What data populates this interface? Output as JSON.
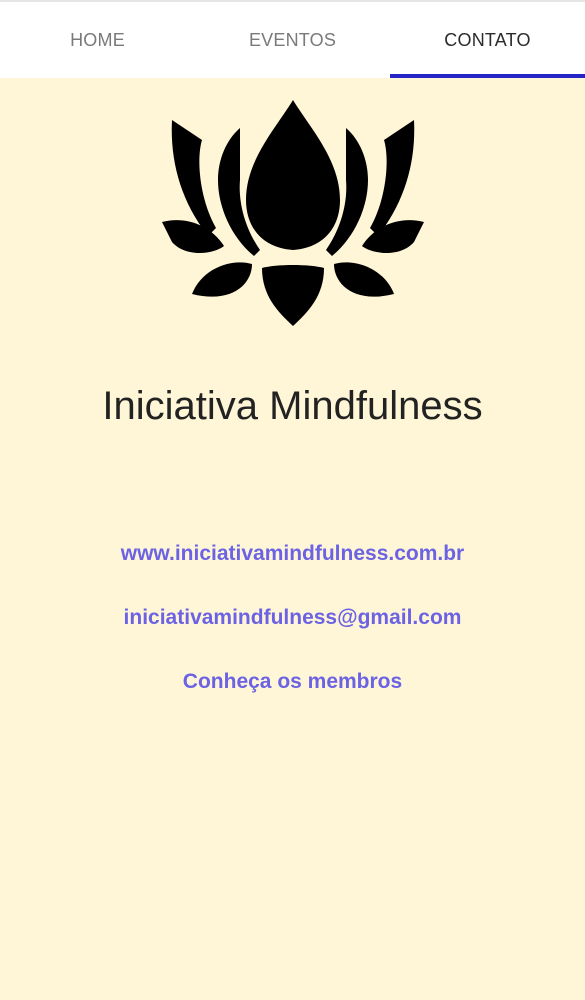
{
  "tabs": [
    {
      "label": "HOME",
      "active": false
    },
    {
      "label": "EVENTOS",
      "active": false
    },
    {
      "label": "CONTATO",
      "active": true
    }
  ],
  "logo": {
    "icon": "lotus-icon",
    "color": "#000000"
  },
  "title": "Iniciativa Mindfulness",
  "links": {
    "website": "www.iniciativamindfulness.com.br",
    "email": "iniciativamindfulness@gmail.com",
    "members": "Conheça os membros"
  },
  "colors": {
    "background": "#FFF6D8",
    "tab_indicator": "#2626C8",
    "link": "#6B63E3"
  }
}
